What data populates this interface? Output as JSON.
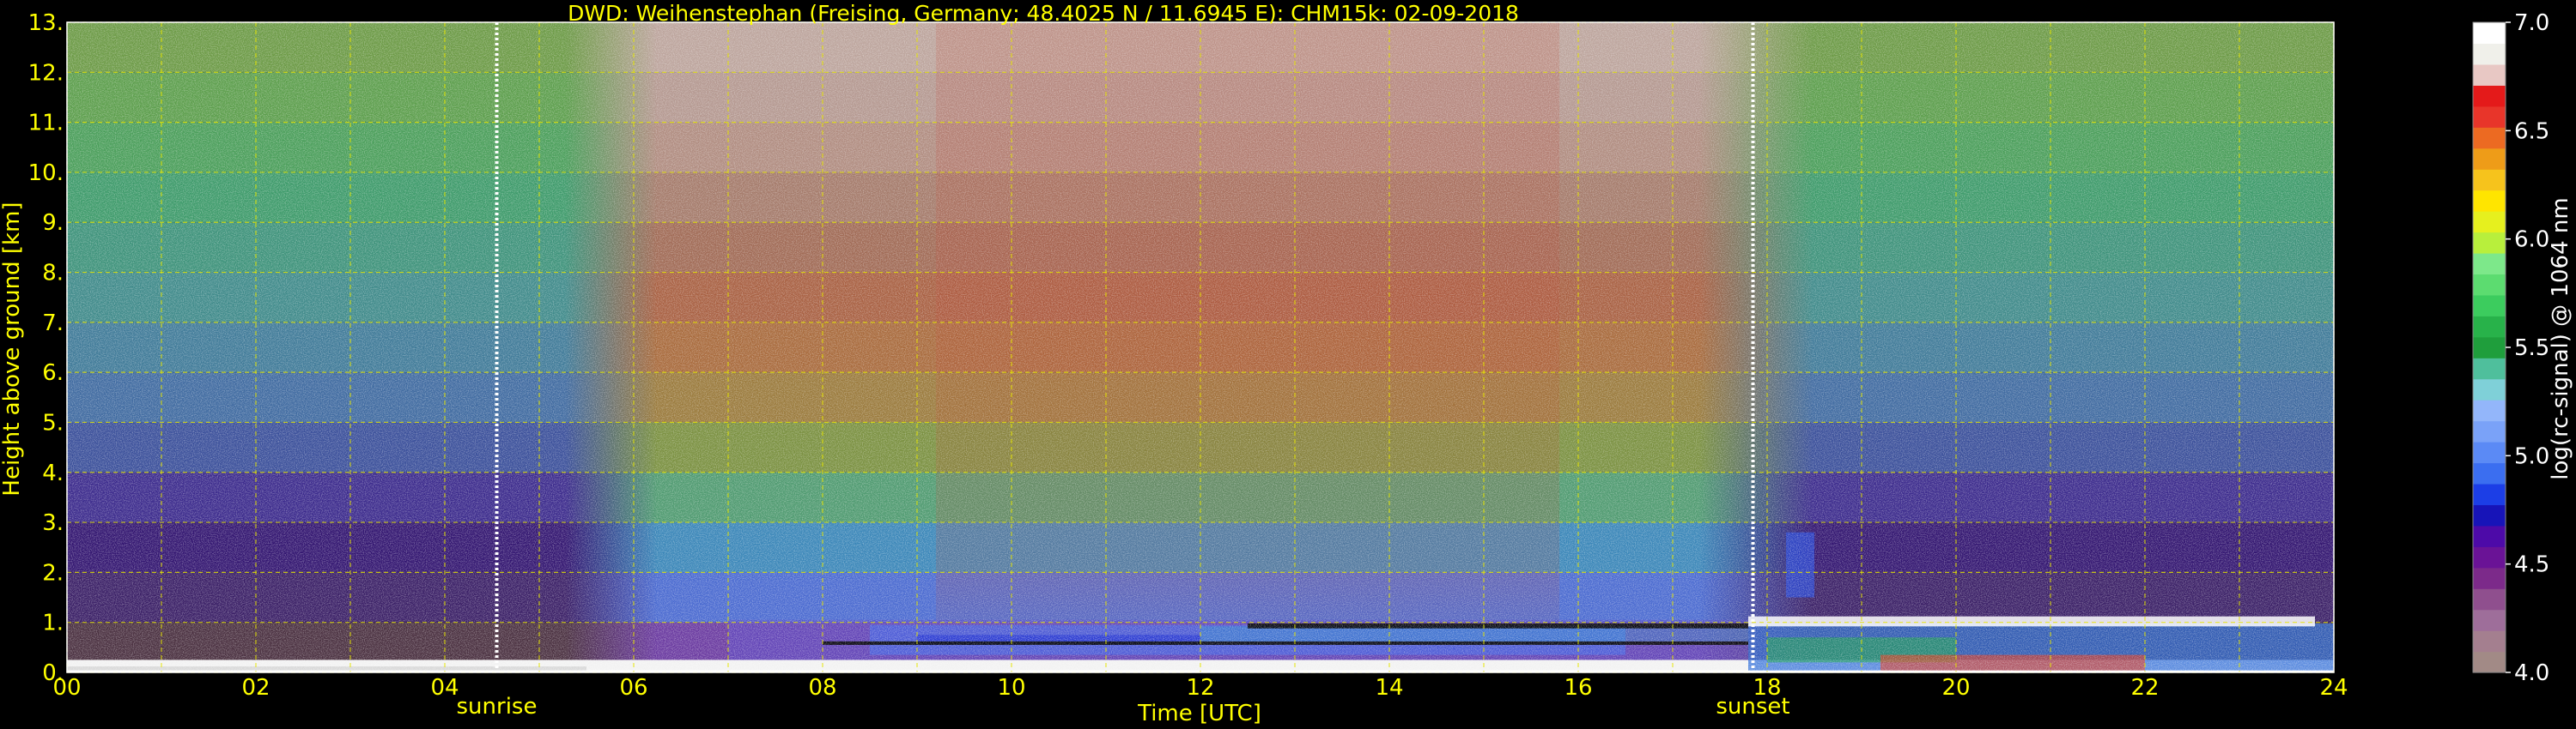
{
  "chart_data": {
    "type": "heatmap",
    "title": "DWD: Weihenstephan (Freising, Germany; 48.4025 N / 11.6945 E):    CHM15k: 02-09-2018",
    "xlabel": "Time [UTC]",
    "ylabel": "Height above ground [km]",
    "x_ticks": [
      "00",
      "02",
      "04",
      "06",
      "08",
      "10",
      "12",
      "14",
      "16",
      "18",
      "20",
      "22",
      "24"
    ],
    "y_ticks": [
      "0.",
      "1.",
      "2.",
      "3.",
      "4.",
      "5.",
      "6.",
      "7.",
      "8.",
      "9.",
      "10.",
      "11.",
      "12.",
      "13."
    ],
    "xlim": [
      0,
      24
    ],
    "ylim": [
      0,
      13
    ],
    "grid": true,
    "annotations": [
      {
        "label": "sunrise",
        "x": 4.55
      },
      {
        "label": "sunset",
        "x": 17.85
      }
    ],
    "colorbar": {
      "label": "log(rc-signal) @ 1064 nm",
      "range": [
        4.0,
        7.0
      ],
      "ticks": [
        "4.0",
        "4.5",
        "5.0",
        "5.5",
        "6.0",
        "6.5",
        "7.0"
      ],
      "colors": [
        "#a28a86",
        "#a47f8f",
        "#9e6e9a",
        "#8f4f8e",
        "#7c2a8a",
        "#6a1396",
        "#4d0aa8",
        "#1714b8",
        "#1c3ee6",
        "#3b6ef0",
        "#5b8af5",
        "#7aa2f8",
        "#93b6fa",
        "#7fd0d8",
        "#4fbf9c",
        "#1f9e3c",
        "#28b24a",
        "#3ccc5e",
        "#5cdc70",
        "#7de88a",
        "#b8ef3c",
        "#e6f01e",
        "#ffe500",
        "#f6c31c",
        "#ee9c18",
        "#ec6a22",
        "#e8352a",
        "#e41a1a",
        "#e8c8c4",
        "#f0f0ea",
        "#ffffff"
      ]
    },
    "colors": {
      "text": "#ffff00",
      "grid": "#e6e600",
      "colorbar_text": "#ffffff",
      "background": "#000000"
    }
  }
}
